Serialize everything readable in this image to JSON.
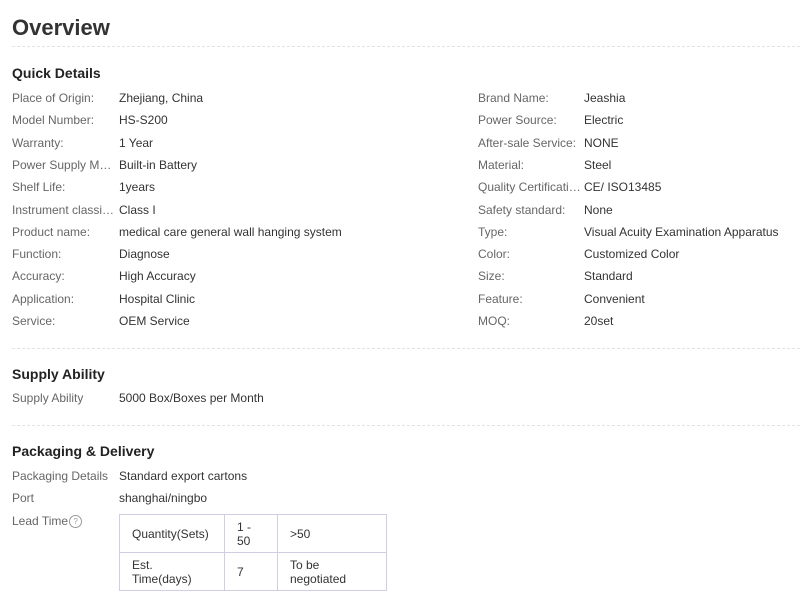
{
  "title": "Overview",
  "quick_details": {
    "heading": "Quick Details",
    "left": [
      {
        "label": "Place of Origin:",
        "value": "Zhejiang, China"
      },
      {
        "label": "Model Number:",
        "value": "HS-S200"
      },
      {
        "label": "Warranty:",
        "value": "1 Year"
      },
      {
        "label": "Power Supply Mode:",
        "value": "Built-in Battery"
      },
      {
        "label": "Shelf Life:",
        "value": "1years"
      },
      {
        "label": "Instrument classifi...",
        "value": "Class I"
      },
      {
        "label": "Product name:",
        "value": "medical care general wall hanging system"
      },
      {
        "label": "Function:",
        "value": "Diagnose"
      },
      {
        "label": "Accuracy:",
        "value": "High Accuracy"
      },
      {
        "label": "Application:",
        "value": "Hospital Clinic"
      },
      {
        "label": "Service:",
        "value": "OEM Service"
      }
    ],
    "right": [
      {
        "label": "Brand Name:",
        "value": "Jeashia"
      },
      {
        "label": "Power Source:",
        "value": "Electric"
      },
      {
        "label": "After-sale Service:",
        "value": "NONE"
      },
      {
        "label": "Material:",
        "value": "Steel"
      },
      {
        "label": "Quality Certification:",
        "value": "CE/ ISO13485"
      },
      {
        "label": "Safety standard:",
        "value": "None"
      },
      {
        "label": "Type:",
        "value": "Visual Acuity Examination Apparatus"
      },
      {
        "label": "Color:",
        "value": "Customized Color"
      },
      {
        "label": "Size:",
        "value": "Standard"
      },
      {
        "label": "Feature:",
        "value": "Convenient"
      },
      {
        "label": "MOQ:",
        "value": "20set"
      }
    ]
  },
  "supply_ability": {
    "heading": "Supply Ability",
    "label": "Supply Ability",
    "value": "5000 Box/Boxes per Month"
  },
  "packaging": {
    "heading": "Packaging & Delivery",
    "details_label": "Packaging Details",
    "details_value": "Standard export cartons",
    "port_label": "Port",
    "port_value": "shanghai/ningbo",
    "lead_time_label": "Lead Time",
    "help_icon": "?",
    "lead_table": {
      "row1": [
        "Quantity(Sets)",
        "1 - 50",
        ">50"
      ],
      "row2": [
        "Est. Time(days)",
        "7",
        "To be negotiated"
      ]
    }
  }
}
